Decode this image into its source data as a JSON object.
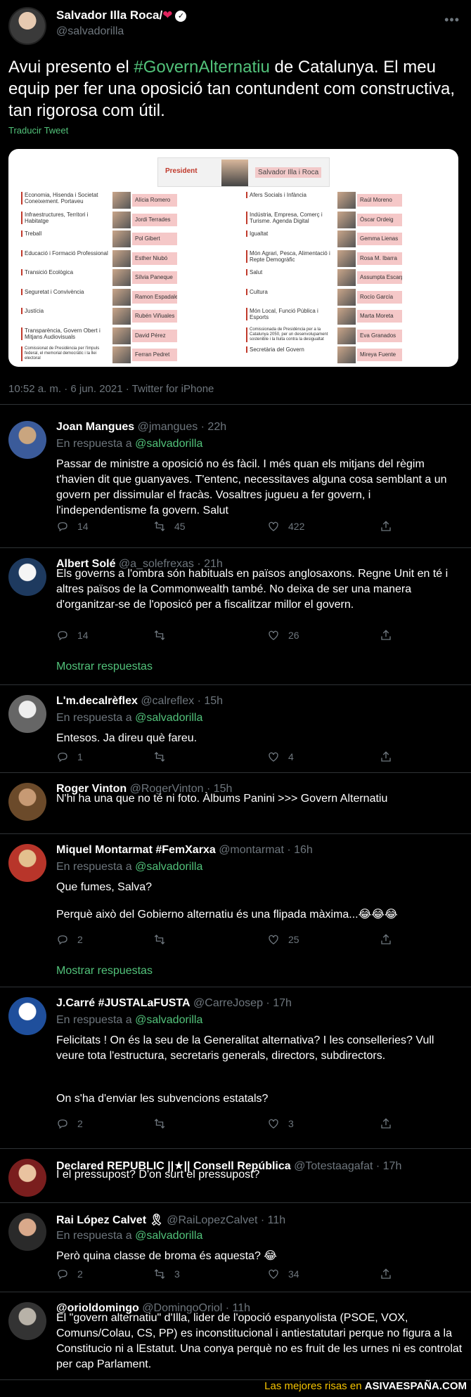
{
  "main_tweet": {
    "author_name": "Salvador Illa Roca/",
    "author_handle": "@salvadorilla",
    "text_before": "Avui presento el ",
    "hashtag": "#GovernAlternatiu",
    "text_after": " de Catalunya. El meu equip per fer una oposició tan contundent com constructiva, tan rigorosa com útil.",
    "translate": "Traducir Tweet",
    "meta": "10:52 a. m. · 6 jun. 2021 · Twitter for iPhone",
    "image": {
      "president_label": "President",
      "president_name": "Salvador Illa i Roca",
      "left": [
        {
          "dept": "Economia, Hisenda i Societat Coneixement. Portaveu",
          "name": "Alícia Romero"
        },
        {
          "dept": "Infraestructures, Territori i Habitatge",
          "name": "Jordi Terrades"
        },
        {
          "dept": "Treball",
          "name": "Pol Gibert"
        },
        {
          "dept": "Educació i Formació Professional",
          "name": "Esther Niubó"
        },
        {
          "dept": "Transició Ecològica",
          "name": "Sílvia Paneque"
        },
        {
          "dept": "Seguretat i Convivència",
          "name": "Ramon Espadaler"
        },
        {
          "dept": "Justícia",
          "name": "Rubén Viñuales"
        },
        {
          "dept": "Transparència, Govern Obert i Mitjans Audiovisuals",
          "name": "David Pérez"
        },
        {
          "dept": "Comissionat de Presidència per l'impuls federal, el memorial democràtic i la llei electoral",
          "name": "Ferran Pedret"
        }
      ],
      "right": [
        {
          "dept": "Afers Socials i Infància",
          "name": "Raúl Moreno"
        },
        {
          "dept": "Indústria, Empresa, Comerç i Turisme. Agenda Digital",
          "name": "Òscar Ordeig"
        },
        {
          "dept": "Igualtat",
          "name": "Gemma Lienas"
        },
        {
          "dept": "Món Agrari, Pesca, Alimentació i Repte Demogràfic",
          "name": "Rosa M. Ibarra"
        },
        {
          "dept": "Salut",
          "name": "Assumpta Escarp"
        },
        {
          "dept": "Cultura",
          "name": "Rocío García"
        },
        {
          "dept": "Món Local, Funció Pública i Esports",
          "name": "Marta Moreta"
        },
        {
          "dept": "Comissionada de Presidència per a la Catalunya 2050, per un desenvolupament sostenible i la lluita contra la desigualtat",
          "name": "Eva Granados"
        },
        {
          "dept": "Secretària del Govern",
          "name": "Mireya Fuente"
        }
      ]
    }
  },
  "replies": [
    {
      "name": "Joan Mangues",
      "handle": "@jmangues · 22h",
      "resp_prefix": "En respuesta a ",
      "resp_to": "@salvadorilla",
      "text": "Passar de ministre a oposició no és fàcil. I més quan els mitjans del règim t'havien dit que guanyaves. T'entenc, necessitaves alguna cosa semblant a un govern per dissimular el fracàs. Vosaltres jugueu a fer govern, i l'independentisme fa govern. Salut",
      "replies": "14",
      "retweets": "45",
      "likes": "422"
    },
    {
      "name": "Albert Solé",
      "handle": "@a_solefrexas · 21h",
      "text": "Els governs a l'ombra són habituals en països anglosaxons. Regne Unit en té i altres països de la Commonwealth també. No deixa de ser una manera d'organitzar-se de l'oposicó per a fiscalitzar millor el govern.",
      "replies": "14",
      "retweets": "",
      "likes": "26",
      "show_more": "Mostrar respuestas"
    },
    {
      "name": "L'm.decalrèflex",
      "handle": "@calreflex · 15h",
      "resp_prefix": "En respuesta a ",
      "resp_to": "@salvadorilla",
      "text": "Entesos. Ja direu què fareu.",
      "replies": "1",
      "retweets": "",
      "likes": "4"
    },
    {
      "name": "Roger Vinton",
      "handle": "@RogerVinton · 15h",
      "text": "N'hi ha una que no té ni foto. Àlbums Panini >>> Govern Alternatiu"
    },
    {
      "name": "Miquel Montarmat #FemXarxa",
      "handle": "@montarmat · 16h",
      "resp_prefix": "En respuesta a ",
      "resp_to": "@salvadorilla",
      "text": "Que fumes, Salva?",
      "text2": "Perquè això del Gobierno alternatiu és una flipada màxima...😂😂😂",
      "replies": "2",
      "retweets": "",
      "likes": "25",
      "show_more": "Mostrar respuestas"
    },
    {
      "name": "J.Carré #JUSTALaFUSTA",
      "handle": "@CarreJosep · 17h",
      "resp_prefix": "En respuesta a ",
      "resp_to": "@salvadorilla",
      "text": "Felicitats !  On és la seu de la Generalitat alternativa? I les conselleries? Vull veure tota l'estructura, secretaris generals, directors, subdirectors.",
      "text2": "On s'ha d'enviar les subvencions estatals?",
      "replies": "2",
      "retweets": "",
      "likes": "3"
    },
    {
      "name": "Declared REPUBLIC ||★|| Consell República",
      "handle": "@Totestaagafat · 17h",
      "text": "I el pressupost? D'on surt el pressupost?"
    },
    {
      "name": "Rai López Calvet 🎗",
      "handle": "@RaiLopezCalvet · 11h",
      "resp_prefix": "En respuesta a ",
      "resp_to": "@salvadorilla",
      "text": "Però quina classe de broma és aquesta? 😂",
      "replies": "2",
      "retweets": "3",
      "likes": "34"
    },
    {
      "name": "@orioldomingo",
      "handle": "@DomingoOriol · 11h",
      "text": "El \"govern alternatiu\" d'Illa, lider de l'opoció espanyolista (PSOE, VOX, Comuns/Colau, CS, PP)  es inconstitucional i antiestatutari perque no figura a la Constitucio ni a lEstatut. Una conya perquè no es fruit de les urnes ni es controlat per cap Parlament."
    }
  ],
  "footer": {
    "prefix": "Las mejores risas en ",
    "brand": "ASIVAESPAÑA.COM"
  },
  "colors": {
    "accent": "#52c27a",
    "muted": "#6e767d",
    "background": "#000000"
  }
}
